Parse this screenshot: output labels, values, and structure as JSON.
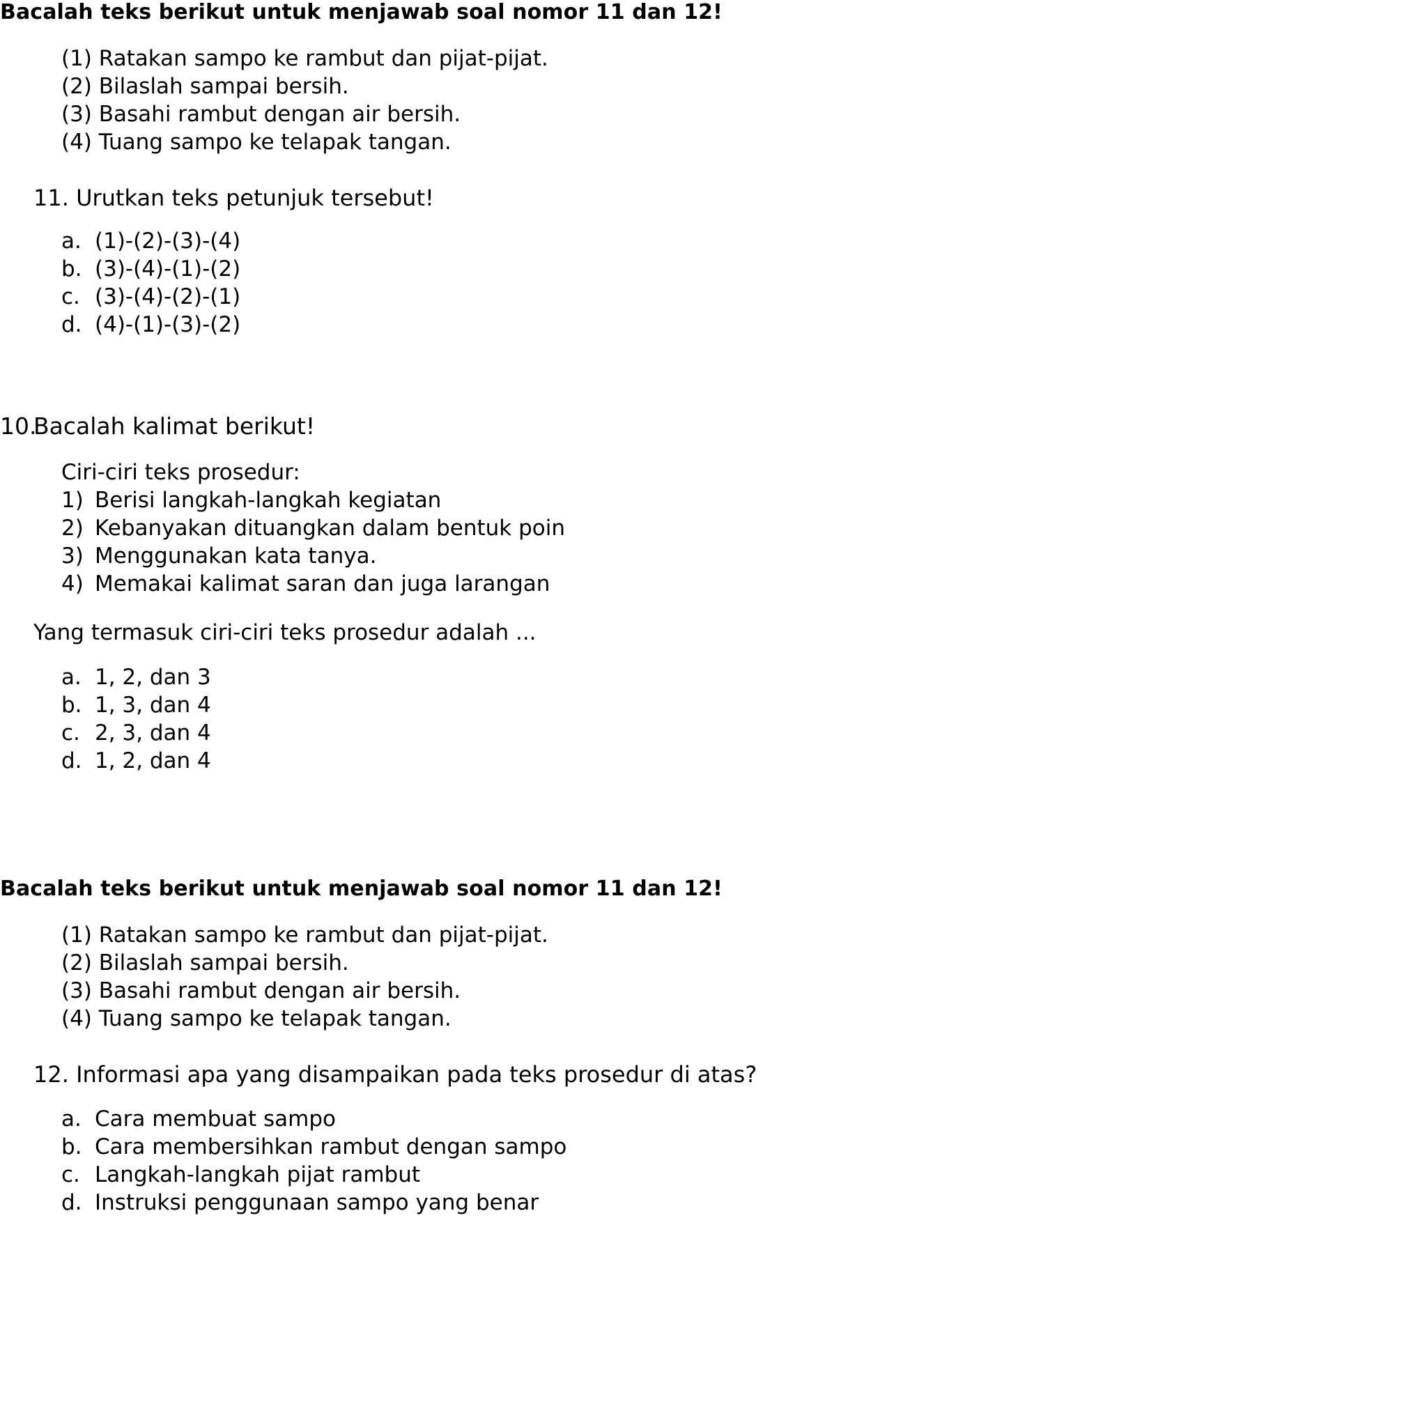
{
  "section1": {
    "heading": "Bacalah teks berikut untuk menjawab soal nomor 11 dan 12!",
    "steps": [
      "(1) Ratakan sampo ke rambut dan pijat-pijat.",
      "(2) Bilaslah sampai bersih.",
      "(3) Basahi rambut dengan air bersih.",
      "(4) Tuang sampo ke telapak tangan."
    ],
    "question": {
      "number": "11.",
      "text": "Urutkan teks petunjuk tersebut!"
    },
    "options": [
      {
        "letter": "a.",
        "text": "(1)-(2)-(3)-(4)"
      },
      {
        "letter": "b.",
        "text": "(3)-(4)-(1)-(2)"
      },
      {
        "letter": "c.",
        "text": "(3)-(4)-(2)-(1)"
      },
      {
        "letter": "d.",
        "text": "(4)-(1)-(3)-(2)"
      }
    ]
  },
  "section2": {
    "question": {
      "number": "10.",
      "text": "Bacalah kalimat berikut!"
    },
    "list_title": "Ciri-ciri teks prosedur:",
    "features": [
      {
        "num": "1)",
        "text": "Berisi langkah-langkah kegiatan"
      },
      {
        "num": "2)",
        "text": "Kebanyakan dituangkan dalam bentuk poin"
      },
      {
        "num": "3)",
        "text": "Menggunakan kata tanya."
      },
      {
        "num": "4)",
        "text": "Memakai kalimat saran dan juga larangan"
      }
    ],
    "prompt": "Yang termasuk ciri-ciri teks prosedur adalah ...",
    "options": [
      {
        "letter": "a.",
        "text": "1, 2, dan 3"
      },
      {
        "letter": "b.",
        "text": "1, 3, dan 4"
      },
      {
        "letter": "c.",
        "text": "2, 3, dan 4"
      },
      {
        "letter": "d.",
        "text": "1, 2, dan 4"
      }
    ]
  },
  "section3": {
    "heading": "Bacalah teks berikut untuk menjawab soal nomor 11 dan 12!",
    "steps": [
      "(1) Ratakan sampo ke rambut dan pijat-pijat.",
      "(2) Bilaslah sampai bersih.",
      "(3) Basahi rambut dengan air bersih.",
      "(4) Tuang sampo ke telapak tangan."
    ],
    "question": {
      "number": "12.",
      "text": "Informasi apa yang disampaikan pada teks prosedur di atas?"
    },
    "options": [
      {
        "letter": "a.",
        "text": "Cara membuat sampo"
      },
      {
        "letter": "b.",
        "text": "Cara membersihkan rambut dengan sampo"
      },
      {
        "letter": "c.",
        "text": "Langkah-langkah pijat rambut"
      },
      {
        "letter": "d.",
        "text": "Instruksi penggunaan sampo yang benar"
      }
    ]
  }
}
